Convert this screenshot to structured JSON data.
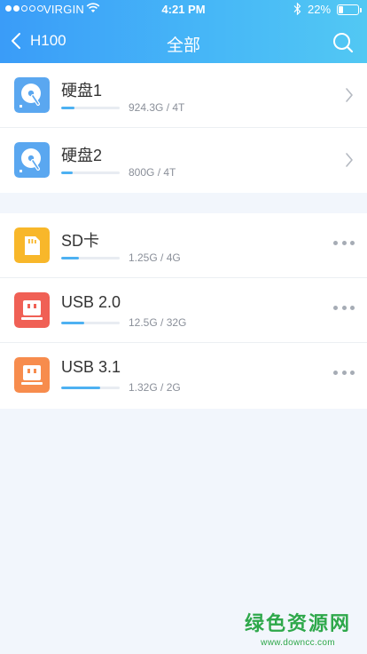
{
  "status_bar": {
    "carrier": "VIRGIN",
    "time": "4:21 PM",
    "battery": "22%",
    "battery_level": 0.22
  },
  "nav": {
    "back_label": "H100",
    "title": "全部",
    "back_icon": "chevron-left-icon",
    "search_icon": "search-icon"
  },
  "disks": [
    {
      "name": "硬盘1",
      "size": "924.3G / 4T",
      "usage": 0.23,
      "icon": "hard-disk-icon",
      "color": "#5aa7f0"
    },
    {
      "name": "硬盘2",
      "size": "800G / 4T",
      "usage": 0.2,
      "icon": "hard-disk-icon",
      "color": "#5aa7f0"
    }
  ],
  "devices": [
    {
      "name": "SD卡",
      "size": "1.25G / 4G",
      "usage": 0.31,
      "icon": "sd-card-icon",
      "color": "#f8b72a"
    },
    {
      "name": "USB 2.0",
      "size": "12.5G / 32G",
      "usage": 0.39,
      "icon": "usb-icon",
      "color": "#f06055"
    },
    {
      "name": "USB 3.1",
      "size": "1.32G / 2G",
      "usage": 0.66,
      "icon": "usb-icon",
      "color": "#f78c4d"
    }
  ],
  "watermark": {
    "title": "绿色资源网",
    "url": "www.downcc.com"
  }
}
